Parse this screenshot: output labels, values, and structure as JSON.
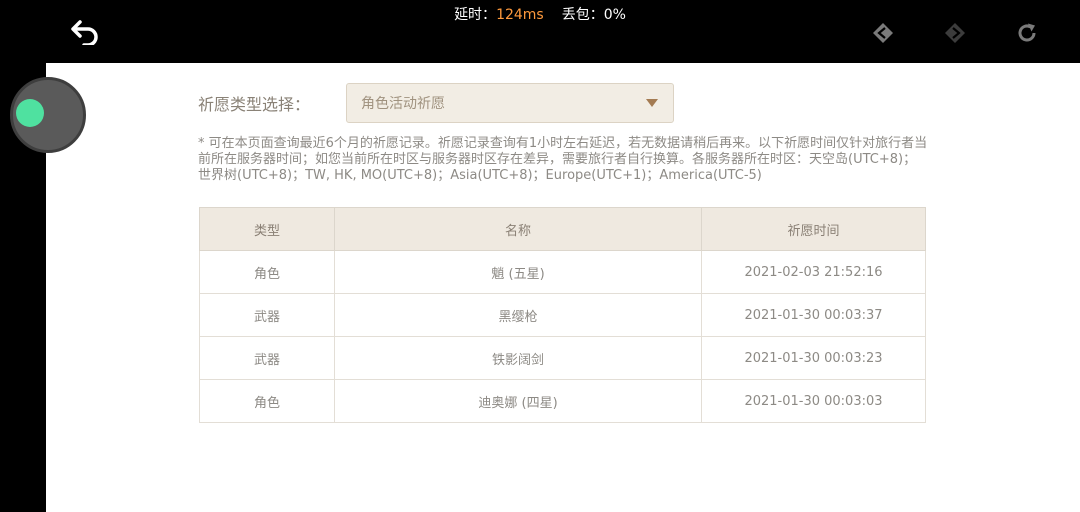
{
  "status": {
    "latency_label": "延时：",
    "latency_value": "124ms",
    "loss_label": "丢包：",
    "loss_value": "0%"
  },
  "icons": {
    "back": "back-arrow-icon",
    "nav_back": "diamond-arrow-left-icon",
    "nav_forward": "diamond-arrow-right-icon",
    "refresh": "refresh-icon"
  },
  "filter": {
    "label": "祈愿类型选择：",
    "selected": "角色活动祈愿"
  },
  "notice": "* 可在本页面查询最近6个月的祈愿记录。祈愿记录查询有1小时左右延迟，若无数据请稍后再来。以下祈愿时间仅针对旅行者当前所在服务器时间；如您当前所在时区与服务器时区存在差异，需要旅行者自行换算。各服务器所在时区：天空岛(UTC+8)；世界树(UTC+8)；TW, HK, MO(UTC+8)；Asia(UTC+8)；Europe(UTC+1)；America(UTC-5)",
  "table": {
    "headers": [
      "类型",
      "名称",
      "祈愿时间"
    ],
    "rows": [
      {
        "type": "角色",
        "name": "魈 (五星)",
        "time": "2021-02-03 21:52:16",
        "rarity": "five"
      },
      {
        "type": "武器",
        "name": "黑缨枪",
        "time": "2021-01-30 00:03:37",
        "rarity": "three"
      },
      {
        "type": "武器",
        "name": "铁影阔剑",
        "time": "2021-01-30 00:03:23",
        "rarity": "three"
      },
      {
        "type": "角色",
        "name": "迪奥娜 (四星)",
        "time": "2021-01-30 00:03:03",
        "rarity": "four"
      }
    ]
  },
  "colors": {
    "five_star": "#c9823f",
    "four_star": "#a56fd6",
    "latency_accent": "#ff9a3d",
    "floating_dot": "#4fe1a0"
  }
}
